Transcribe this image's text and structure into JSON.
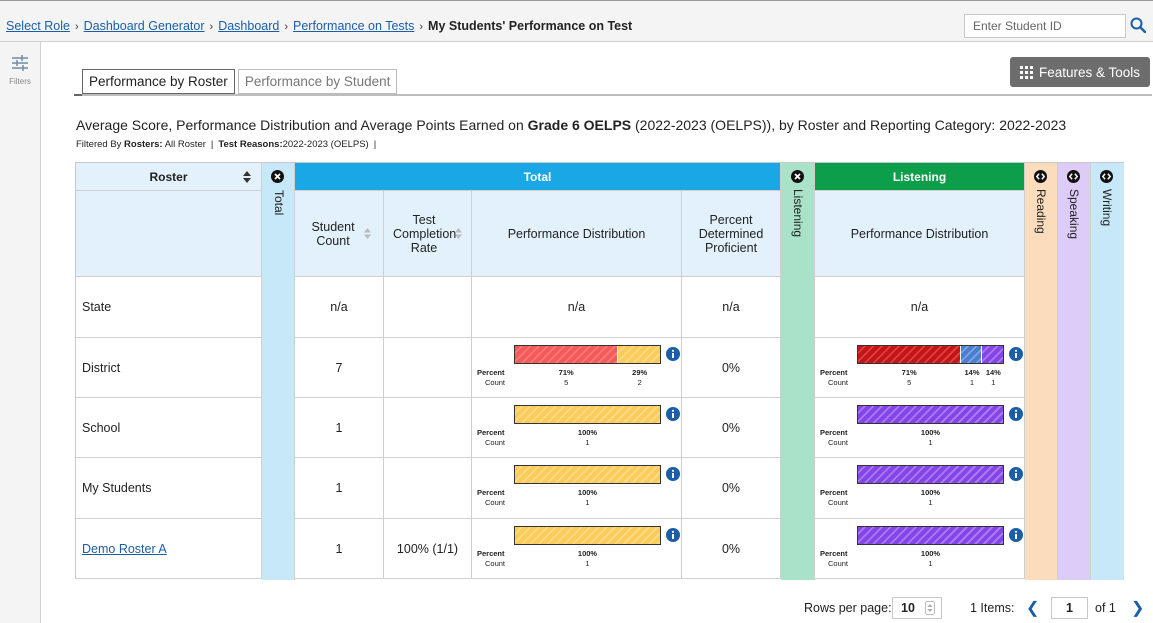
{
  "breadcrumb": {
    "items": [
      "Select Role",
      "Dashboard Generator",
      "Dashboard",
      "Performance on Tests"
    ],
    "current": "My Students' Performance on Test",
    "separator": "›"
  },
  "search": {
    "placeholder": "Enter Student ID",
    "icon": "search-icon"
  },
  "left_rail": {
    "filters_label": "Filters",
    "icon": "filters-sliders-icon"
  },
  "tabs": [
    {
      "label": "Performance by Roster",
      "active": true
    },
    {
      "label": "Performance by Student",
      "active": false
    }
  ],
  "features_tools": {
    "label": "Features & Tools",
    "icon": "grid-dots-icon"
  },
  "report": {
    "title_prefix": "Average Score, Performance Distribution and Average Points Earned on ",
    "title_test": "Grade 6 OELPS",
    "title_suffix": " (2022-2023 (OELPS)), by Roster and Reporting Category: 2022-2023",
    "filter_label": "Filtered By",
    "rosters_label": "Rosters:",
    "rosters_value": "All Roster",
    "test_reasons_label": "Test Reasons:",
    "test_reasons_value": "2022-2023 (OELPS)"
  },
  "table": {
    "roster_header": "Roster",
    "total_collapsed_label": "Total",
    "total_group_label": "Total",
    "listening_collapsed_label": "Listening",
    "listening_group_label": "Listening",
    "reading_label": "Reading",
    "speaking_label": "Speaking",
    "writing_label": "Writing",
    "columns": {
      "student_count": "Student Count",
      "test_completion_rate": "Test Completion Rate",
      "performance_distribution": "Performance Distribution",
      "percent_determined_proficient": "Percent Determined Proficient",
      "listening_performance_distribution": "Performance Distribution"
    },
    "dist_labels": {
      "percent": "Percent",
      "count": "Count"
    },
    "rows": [
      {
        "name": "State",
        "link": false,
        "student_count": "n/a",
        "completion": "",
        "total_dist": {
          "na": "n/a"
        },
        "proficient": "n/a",
        "listening_dist": {
          "na": "n/a"
        }
      },
      {
        "name": "District",
        "link": false,
        "student_count": "7",
        "completion": "",
        "total_dist": {
          "segments": [
            {
              "level": "red",
              "percent": "71%",
              "count": "5",
              "share": 0.71
            },
            {
              "level": "yellow",
              "percent": "29%",
              "count": "2",
              "share": 0.29
            }
          ]
        },
        "proficient": "0%",
        "listening_dist": {
          "segments": [
            {
              "level": "darkred",
              "percent": "71%",
              "count": "5",
              "share": 0.71
            },
            {
              "level": "blue",
              "percent": "14%",
              "count": "1",
              "share": 0.145
            },
            {
              "level": "purple",
              "percent": "14%",
              "count": "1",
              "share": 0.145
            }
          ]
        }
      },
      {
        "name": "School",
        "link": false,
        "student_count": "1",
        "completion": "",
        "total_dist": {
          "segments": [
            {
              "level": "yellow",
              "percent": "100%",
              "count": "1",
              "share": 1
            }
          ]
        },
        "proficient": "0%",
        "listening_dist": {
          "segments": [
            {
              "level": "purple",
              "percent": "100%",
              "count": "1",
              "share": 1
            }
          ]
        }
      },
      {
        "name": "My Students",
        "link": false,
        "student_count": "1",
        "completion": "",
        "total_dist": {
          "segments": [
            {
              "level": "yellow",
              "percent": "100%",
              "count": "1",
              "share": 1
            }
          ]
        },
        "proficient": "0%",
        "listening_dist": {
          "segments": [
            {
              "level": "purple",
              "percent": "100%",
              "count": "1",
              "share": 1
            }
          ]
        }
      },
      {
        "name": "Demo Roster A",
        "link": true,
        "student_count": "1",
        "completion": "100% (1/1)",
        "total_dist": {
          "segments": [
            {
              "level": "yellow",
              "percent": "100%",
              "count": "1",
              "share": 1
            }
          ]
        },
        "proficient": "0%",
        "listening_dist": {
          "segments": [
            {
              "level": "purple",
              "percent": "100%",
              "count": "1",
              "share": 1
            }
          ]
        }
      }
    ]
  },
  "pager": {
    "rows_per_page_label": "Rows per page:",
    "rows_per_page": "10",
    "items_label": "1 Items:",
    "page": "1",
    "of_label": "of 1"
  },
  "colors": {
    "total_header": "#1aa7e6",
    "listening_header": "#0c9e4a",
    "light_blue": "#e2f1fb",
    "total_strip": "#c6e8f8",
    "listening_strip": "#a9e2c8",
    "reading_strip": "#fbdcbc",
    "speaking_strip": "#dcccf7",
    "writing_strip": "#c6e8f8",
    "red": "#f45a5a",
    "darkred": "#c41414",
    "yellow": "#fccb5a",
    "blue": "#4a7fd0",
    "purple": "#8444e8",
    "info": "#1a5ea8",
    "link": "#1a5ea8"
  }
}
